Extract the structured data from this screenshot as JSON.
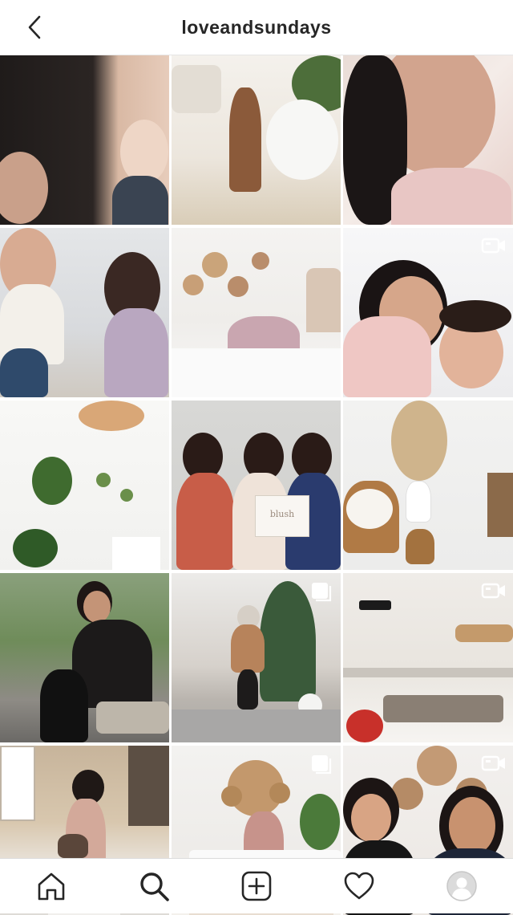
{
  "header": {
    "title": "loveandsundays",
    "back_icon": "chevron-left-icon"
  },
  "grid": {
    "posts": [
      {
        "row": 1,
        "col": 1,
        "badge": null
      },
      {
        "row": 1,
        "col": 2,
        "badge": null
      },
      {
        "row": 1,
        "col": 3,
        "badge": null
      },
      {
        "row": 2,
        "col": 1,
        "badge": null
      },
      {
        "row": 2,
        "col": 2,
        "badge": null
      },
      {
        "row": 2,
        "col": 3,
        "badge": "video-icon"
      },
      {
        "row": 3,
        "col": 1,
        "badge": null
      },
      {
        "row": 3,
        "col": 2,
        "badge": null
      },
      {
        "row": 3,
        "col": 3,
        "badge": null
      },
      {
        "row": 4,
        "col": 1,
        "badge": null
      },
      {
        "row": 4,
        "col": 2,
        "badge": "carousel-icon"
      },
      {
        "row": 4,
        "col": 3,
        "badge": "video-icon"
      },
      {
        "row": 5,
        "col": 1,
        "badge": null
      },
      {
        "row": 5,
        "col": 2,
        "badge": "carousel-icon"
      },
      {
        "row": 5,
        "col": 3,
        "badge": "video-icon"
      }
    ],
    "box_label_in_post_8": "blush"
  },
  "bottom_nav": {
    "items": [
      "home-icon",
      "search-icon",
      "new-post-icon",
      "activity-heart-icon",
      "profile-avatar-icon"
    ],
    "active": "search-icon"
  },
  "colors": {
    "text": "#262626",
    "divider": "#dbdbdb",
    "background": "#ffffff"
  }
}
